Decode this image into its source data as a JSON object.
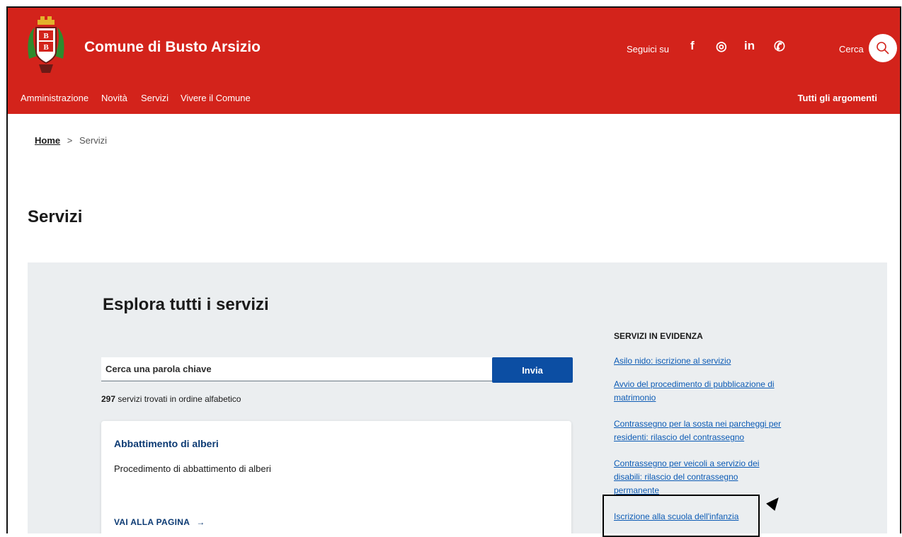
{
  "header": {
    "site_title": "Comune di Busto Arsizio",
    "follow_label": "Seguici su",
    "social": [
      {
        "name": "facebook-icon",
        "glyph": "f"
      },
      {
        "name": "instagram-icon",
        "glyph": "◎"
      },
      {
        "name": "linkedin-icon",
        "glyph": "in"
      },
      {
        "name": "whatsapp-icon",
        "glyph": "✆"
      }
    ],
    "search_label": "Cerca",
    "accent": "#d3231b"
  },
  "nav": {
    "items": [
      "Amministrazione",
      "Novità",
      "Servizi",
      "Vivere il Comune"
    ],
    "topics": "Tutti gli argomenti"
  },
  "breadcrumb": {
    "home": "Home",
    "separator": ">",
    "current": "Servizi"
  },
  "page_title": "Servizi",
  "explore": {
    "title": "Esplora tutti i servizi",
    "search_placeholder": "Cerca una parola chiave",
    "submit_label": "Invia",
    "count_number": "297",
    "count_text": " servizi trovati in ordine alfabetico"
  },
  "card": {
    "title": "Abbattimento di alberi",
    "description": "Procedimento di abbattimento di alberi",
    "link_label": "VAI ALLA PAGINA",
    "arrow": "→"
  },
  "featured": {
    "title": "SERVIZI IN EVIDENZA",
    "links": [
      "Asilo nido: iscrizione al servizio",
      "Avvio del procedimento di pubblicazione di matrimonio",
      "Contrassegno per la sosta nei parcheggi per residenti: rilascio del contrassegno",
      "Contrassegno per veicoli a servizio dei disabili: rilascio del contrassegno permanente",
      "Iscrizione alla scuola dell'infanzia"
    ]
  },
  "colors": {
    "brand_red": "#d3231b",
    "primary_blue": "#0c4ea3",
    "link_blue": "#0c5bb5",
    "panel_gray": "#ebeef0"
  }
}
